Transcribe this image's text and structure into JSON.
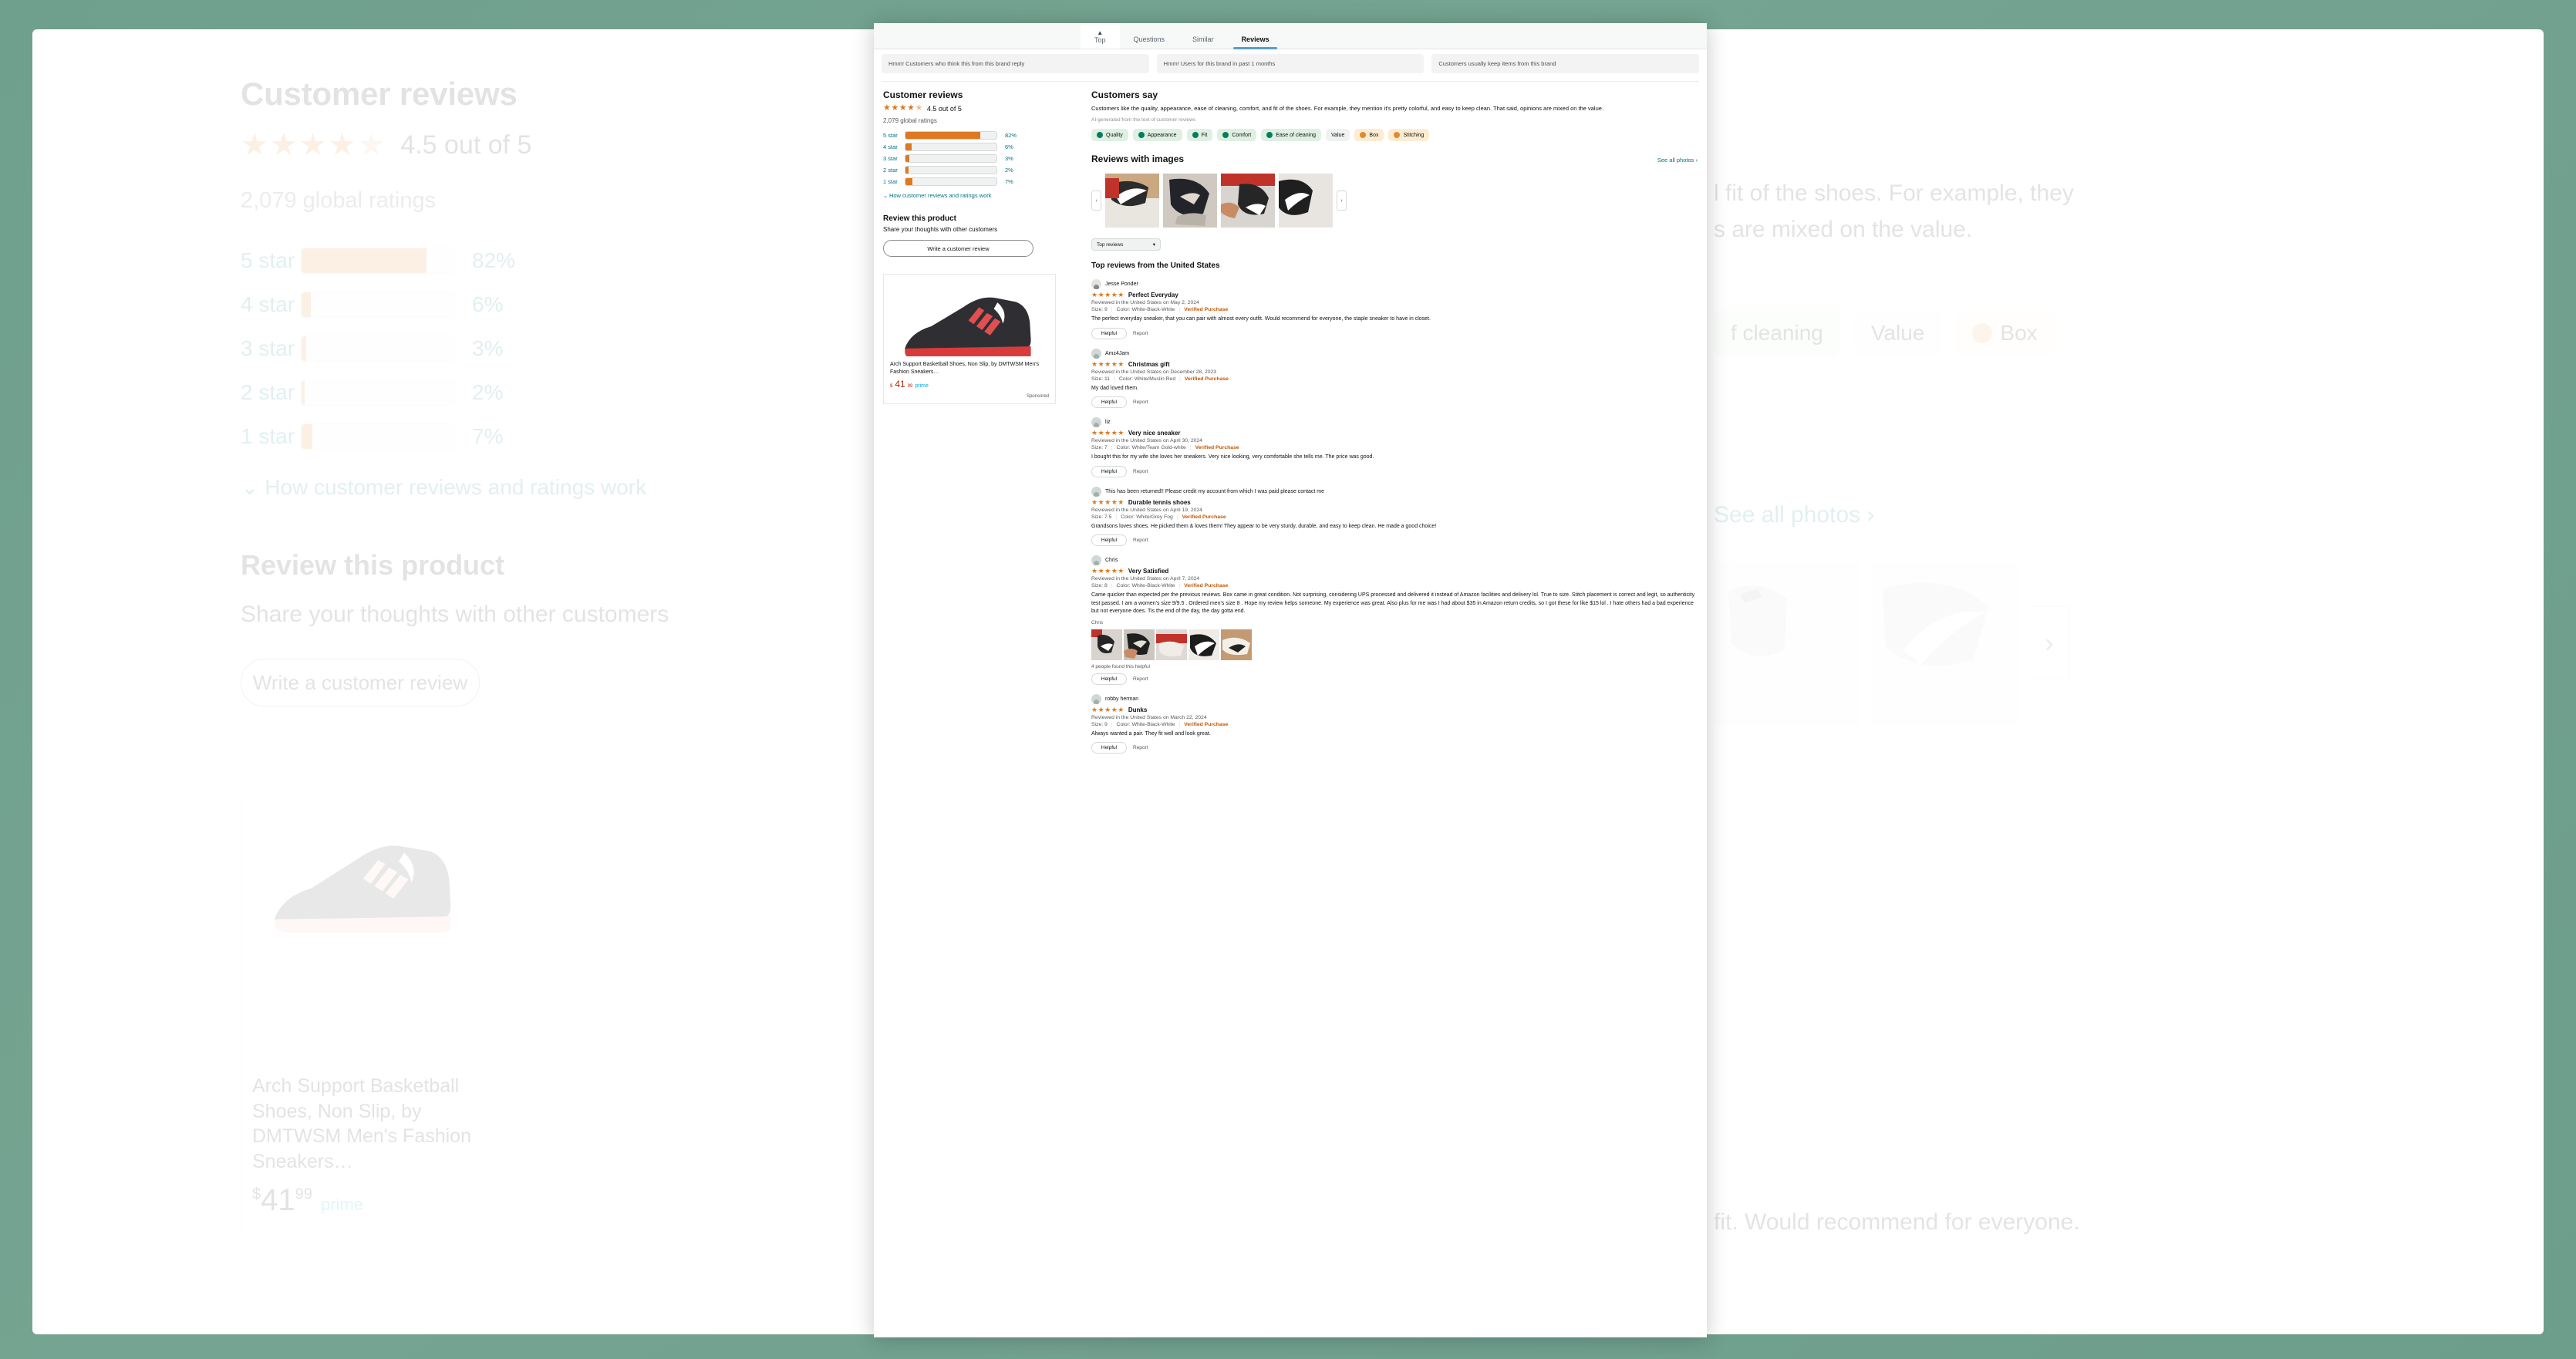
{
  "background": {
    "heading": "Customer reviews",
    "stars": "★★★★",
    "half_star": "★",
    "rating_text": "4.5 out of 5",
    "global_ratings": "2,079 global ratings",
    "bars": [
      {
        "label": "5 star",
        "pct": "82%",
        "value": 82
      },
      {
        "label": "4 star",
        "pct": "6%",
        "value": 6
      },
      {
        "label": "3 star",
        "pct": "3%",
        "value": 3
      },
      {
        "label": "2 star",
        "pct": "2%",
        "value": 2
      },
      {
        "label": "1 star",
        "pct": "7%",
        "value": 7
      }
    ],
    "how_link": "How customer reviews and ratings work",
    "review_heading": "Review this product",
    "review_sub": "Share your thoughts with other customers",
    "write_button": "Write a customer review",
    "product": {
      "title": "Arch Support Basketball Shoes, Non Slip, by DMTWSM Men's Fashion Sneakers…",
      "price_dollar": "$",
      "price_whole": "41",
      "price_cents": "99",
      "prime": "prime"
    },
    "right_text_line1": "l fit of the shoes. For example, they",
    "right_text_line2": "s are mixed on the value.",
    "chips": [
      "f cleaning",
      "Value",
      "Box"
    ],
    "see_all_photos": "See all photos ›",
    "bottom_text": "fit. Would recommend for everyone."
  },
  "overlay": {
    "tabs": [
      {
        "label": "Top",
        "icon": "caret-up-icon",
        "state": "pinned"
      },
      {
        "label": "Questions",
        "state": "inactive"
      },
      {
        "label": "Similar",
        "state": "inactive"
      },
      {
        "label": "Reviews",
        "state": "active"
      }
    ],
    "notices": [
      "Hmm! Customers who think this from this brand reply",
      "Hmm! Users for this brand in past 1 months",
      "Customers usually keep items from this brand"
    ],
    "reviews_summary": {
      "heading": "Customer reviews",
      "stars": "★★★★",
      "half_star": "★",
      "rating_text": "4.5 out of 5",
      "global_ratings": "2,079 global ratings",
      "bars": [
        {
          "label": "5 star",
          "pct": "82%",
          "value": 82
        },
        {
          "label": "4 star",
          "pct": "6%",
          "value": 6
        },
        {
          "label": "3 star",
          "pct": "3%",
          "value": 3
        },
        {
          "label": "2 star",
          "pct": "2%",
          "value": 2
        },
        {
          "label": "1 star",
          "pct": "7%",
          "value": 7
        }
      ],
      "how_link": "How customer reviews and ratings work"
    },
    "review_product": {
      "heading": "Review this product",
      "sub": "Share your thoughts with other customers",
      "button": "Write a customer review"
    },
    "sponsored_card": {
      "title": "Arch Support Basketball Shoes, Non Slip, by DMTWSM Men's Fashion Sneakers…",
      "price_dollar": "$",
      "price_whole": "41",
      "price_cents": "99",
      "prime": "prime",
      "sponsored_label": "Sponsored"
    },
    "customers_say": {
      "heading": "Customers say",
      "body": "Customers like the quality, appearance, ease of cleaning, comfort, and fit of the shoes. For example, they mention it's pretty colorful, and easy to keep clean. That said, opinions are mixed on the value.",
      "ai_note": "AI-generated from the text of customer reviews",
      "chips": [
        {
          "label": "Quality",
          "sentiment": "positive"
        },
        {
          "label": "Appearance",
          "sentiment": "positive"
        },
        {
          "label": "Fit",
          "sentiment": "positive"
        },
        {
          "label": "Comfort",
          "sentiment": "positive"
        },
        {
          "label": "Ease of cleaning",
          "sentiment": "positive"
        },
        {
          "label": "Value",
          "sentiment": "neutral"
        },
        {
          "label": "Box",
          "sentiment": "negative"
        },
        {
          "label": "Stitching",
          "sentiment": "negative"
        }
      ]
    },
    "reviews_with_images": {
      "heading": "Reviews with images",
      "see_all": "See all photos ›",
      "prev": "‹",
      "next": "›"
    },
    "sort_select": {
      "value": "Top reviews",
      "caret": "▾"
    },
    "top_reviews_heading": "Top reviews from the United States",
    "reviews": [
      {
        "name": "Jesse Ponder",
        "stars": "★★★★★",
        "title": "Perfect Everyday",
        "meta": "Reviewed in the United States on May 2, 2024",
        "size": "Size: 9",
        "color": "Color: White-Black-White",
        "verified": "Verified Purchase",
        "body": "The perfect everyday sneaker, that you can pair with almost every outfit. Would recommend for everyone, the staple sneaker to have in closet.",
        "helpful": "Helpful",
        "report": "Report"
      },
      {
        "name": "Amz4Jam",
        "stars": "★★★★★",
        "title": "Christmas gift",
        "meta": "Reviewed in the United States on December 28, 2023",
        "size": "Size: 11",
        "color": "Color: White/Muslin Red",
        "verified": "Verified Purchase",
        "body": "My dad loved them.",
        "helpful": "Helpful",
        "report": "Report"
      },
      {
        "name": "liz",
        "stars": "★★★★★",
        "title": "Very nice sneaker",
        "meta": "Reviewed in the United States on April 30, 2024",
        "size": "Size: 7",
        "color": "Color: White/Team Gold-white",
        "verified": "Verified Purchase",
        "body": "I bought this for my wife she loves her sneakers. Very nice looking, very comfortable she tells me. The price was good.",
        "helpful": "Helpful",
        "report": "Report"
      },
      {
        "name": "This has been returned!! Please credit my account from which I was paid please contact me",
        "stars": "★★★★★",
        "title": "Durable tennis shoes",
        "meta": "Reviewed in the United States on April 19, 2024",
        "size": "Size: 7.5",
        "color": "Color: White/Grey Fog",
        "verified": "Verified Purchase",
        "body": "Grandsons loves shoes. He picked them & loves them! They appear to be very sturdy, durable, and easy to keep clean. He made a good choice!",
        "helpful": "Helpful",
        "report": "Report"
      },
      {
        "name": "Chris",
        "stars": "★★★★★",
        "title": "Very Satisfied",
        "meta": "Reviewed in the United States on April 7, 2024",
        "size": "Size: 8",
        "color": "Color: White-Black-White",
        "verified": "Verified Purchase",
        "body": "Came quicker than expected per the previous reviews. Box came in great condition. Not surprising, considering UPS processed and delivered it instead of Amazon facilities and delivery lol. True to size. Stitch placement is correct and legit, so authenticity test passed. I am a women's size 9/9.5 . Ordered men's size 8 . Hope my review helps someone. My experience was great. Also plus for me was I had about $35 in Amazon return credits, so I got these for like $15 lol . I hate others had a bad experience but not everyone does. Tis the end of the day, the day gotta end.",
        "photo_caption": "Chris",
        "helpful_count": "4 people found this helpful",
        "helpful": "Helpful",
        "report": "Report"
      },
      {
        "name": "robby herman",
        "stars": "★★★★★",
        "title": "Dunks",
        "meta": "Reviewed in the United States on March 22, 2024",
        "size": "Size: 9",
        "color": "Color: White-Black-White",
        "verified": "Verified Purchase",
        "body": "Always wanted a pair. They fit well and look great.",
        "helpful": "Helpful",
        "report": "Report"
      }
    ]
  },
  "colors": {
    "amazon_orange": "#de7921",
    "link_teal": "#007185",
    "verified_orange": "#c45500",
    "price_red": "#b12704",
    "positive_green": "#067d62",
    "negative_orange": "#e08b2e",
    "tab_active_blue": "#5a9ec7",
    "frame_teal": "#6fa08d"
  }
}
